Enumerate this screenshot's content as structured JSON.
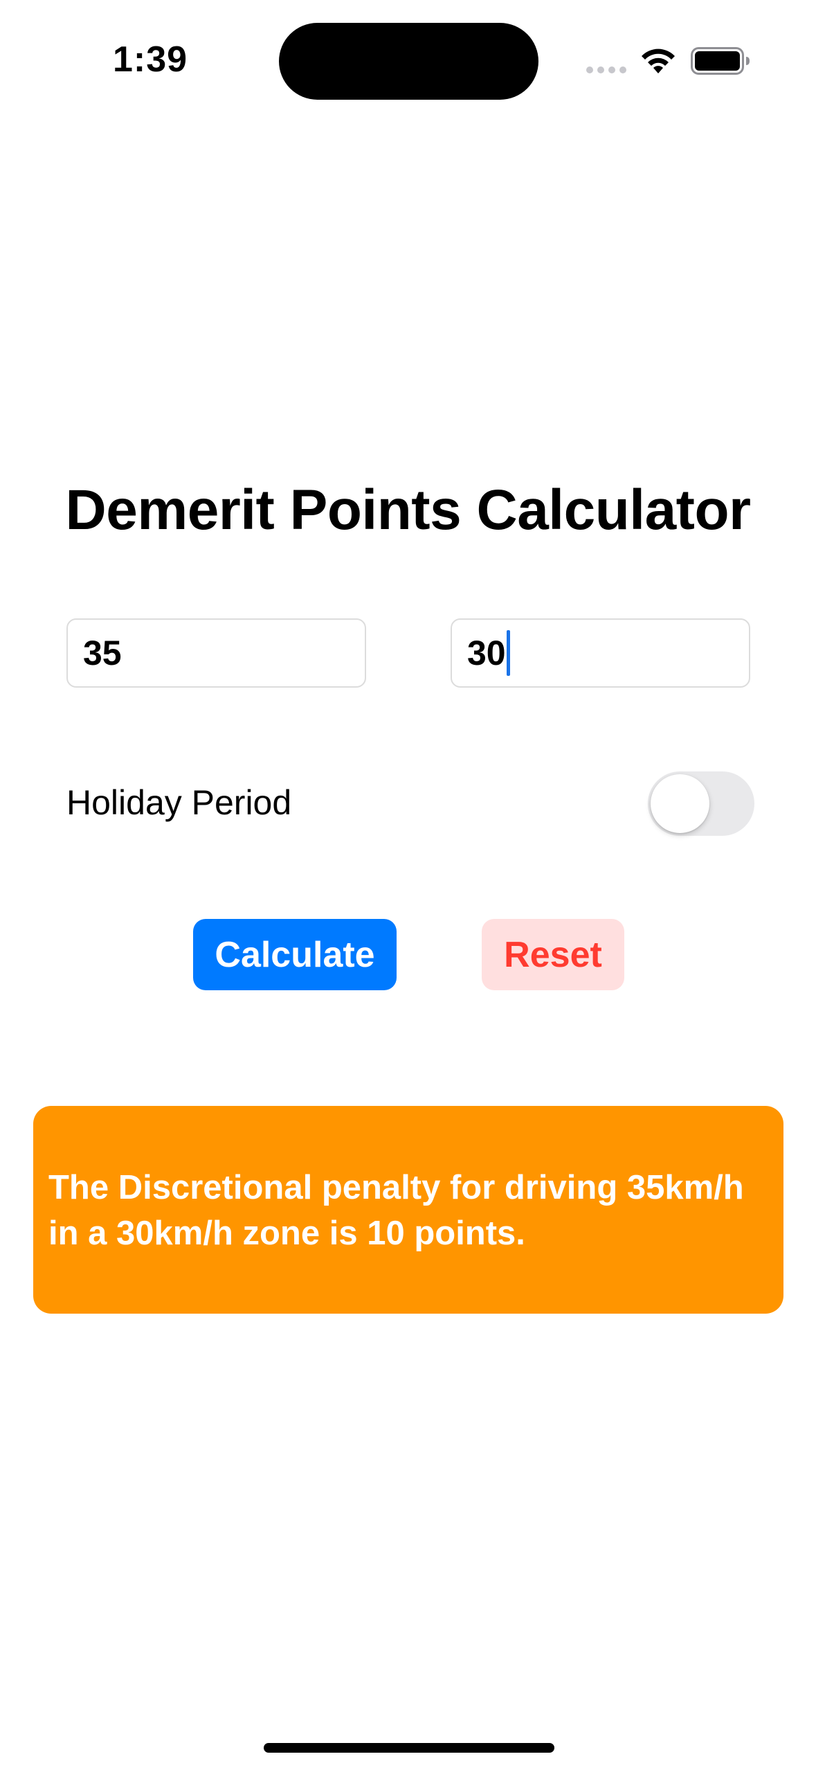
{
  "status_bar": {
    "time": "1:39"
  },
  "icons": {
    "signal": "cellular-signal-icon",
    "wifi": "wifi-icon",
    "battery": "battery-icon"
  },
  "title": "Demerit Points Calculator",
  "inputs": {
    "speed_value": "35",
    "limit_value": "30"
  },
  "holiday": {
    "label": "Holiday Period",
    "enabled": false
  },
  "buttons": {
    "calculate": "Calculate",
    "reset": "Reset"
  },
  "result": {
    "text": "The Discretional penalty for driving 35km/h in a 30km/h zone is 10 points."
  },
  "colors": {
    "accent_blue": "#007aff",
    "reset_red": "#ff3b30",
    "reset_bg": "#ffdfdf",
    "result_orange": "#ff9500",
    "toggle_off": "#e9e9eb"
  }
}
